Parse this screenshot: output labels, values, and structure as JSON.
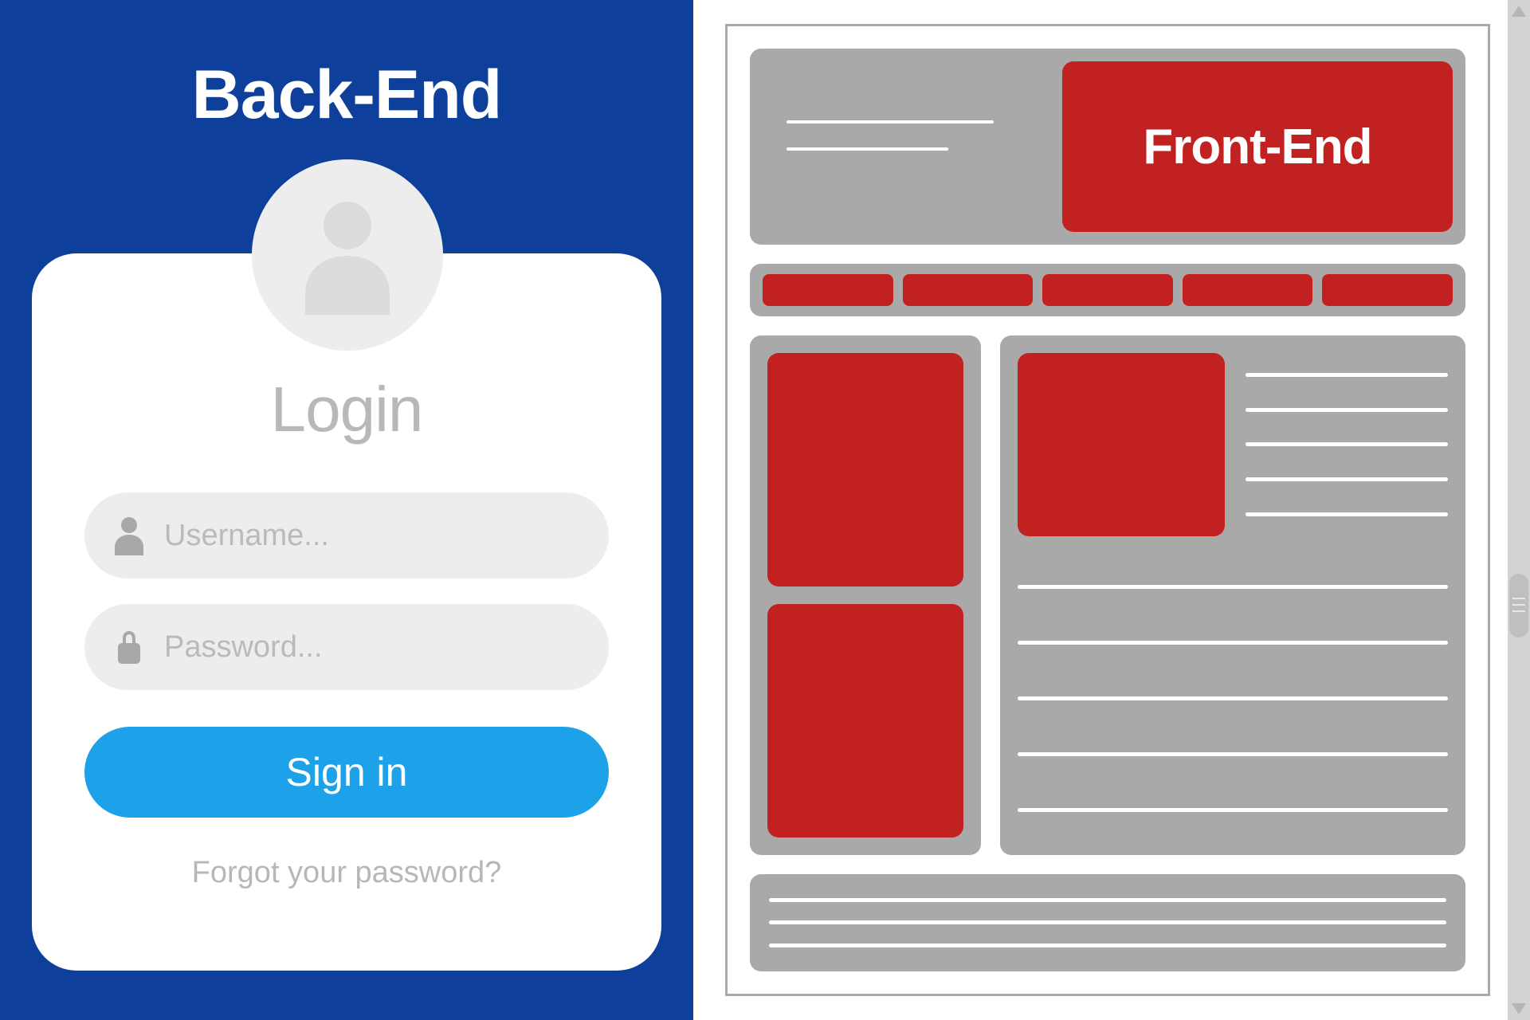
{
  "backend": {
    "title": "Back-End",
    "login_heading": "Login",
    "username_placeholder": "Username...",
    "password_placeholder": "Password...",
    "signin_label": "Sign in",
    "forgot_label": "Forgot your password?"
  },
  "frontend": {
    "title": "Front-End"
  }
}
